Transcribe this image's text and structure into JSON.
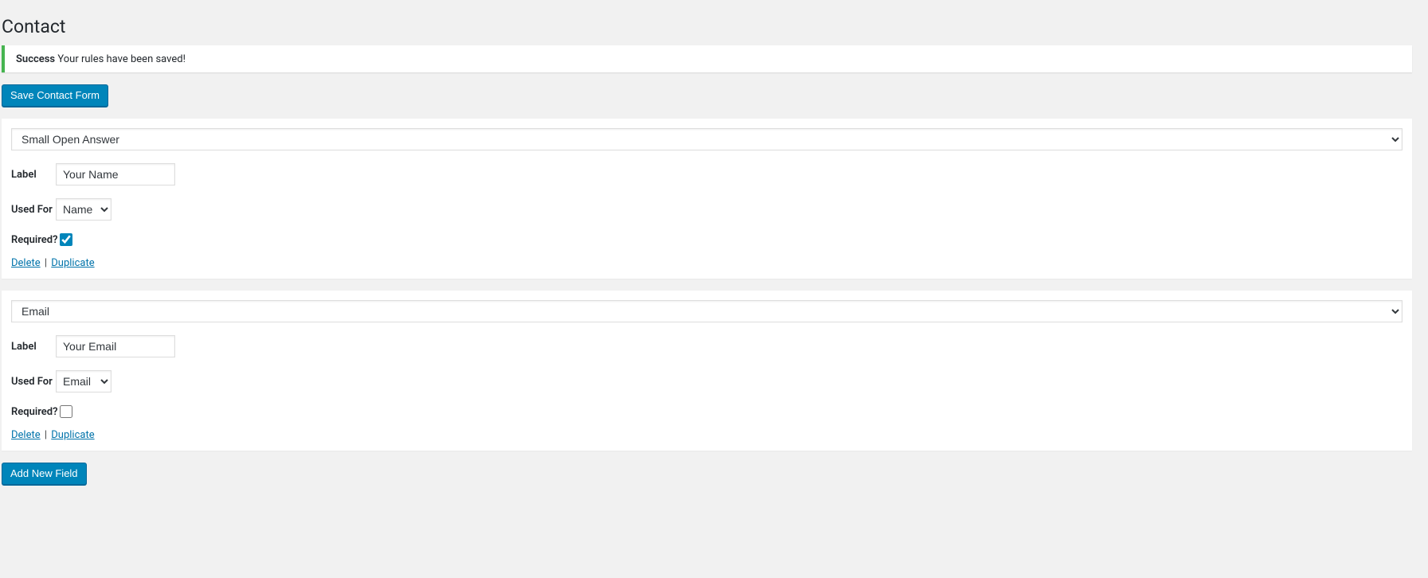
{
  "page": {
    "title": "Contact"
  },
  "notice": {
    "strong": "Success",
    "text": " Your rules have been saved!"
  },
  "buttons": {
    "save": "Save Contact Form",
    "add_new": "Add New Field"
  },
  "labels": {
    "label": "Label",
    "used_for": "Used For",
    "required": "Required?",
    "delete": "Delete",
    "duplicate": "Duplicate",
    "sep": " | "
  },
  "fields": [
    {
      "type": "Small Open Answer",
      "label_value": "Your Name",
      "used_for": "Name",
      "required": true
    },
    {
      "type": "Email",
      "label_value": "Your Email",
      "used_for": "Email",
      "required": false
    }
  ]
}
